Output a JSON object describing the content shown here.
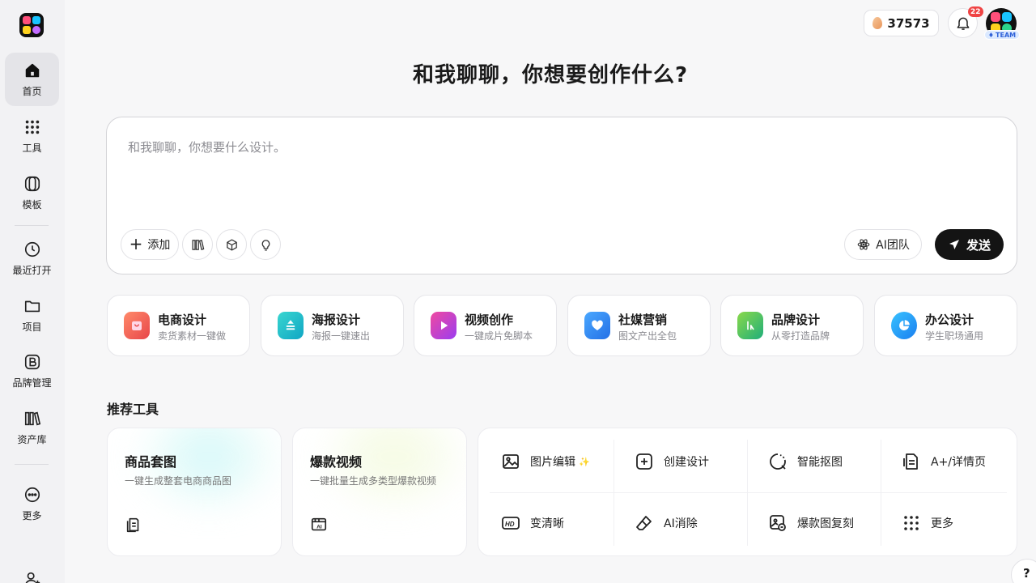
{
  "sidebar": {
    "items": [
      {
        "label": "首页",
        "icon": "home-icon"
      },
      {
        "label": "工具",
        "icon": "grid-dots-icon"
      },
      {
        "label": "模板",
        "icon": "template-icon"
      },
      {
        "label": "最近打开",
        "icon": "clock-icon"
      },
      {
        "label": "项目",
        "icon": "folder-icon"
      },
      {
        "label": "品牌管理",
        "icon": "brand-icon"
      },
      {
        "label": "资产库",
        "icon": "library-icon"
      },
      {
        "label": "更多",
        "icon": "more-icon"
      }
    ],
    "active_index": 0
  },
  "header": {
    "credits": "37573",
    "notification_count": "22",
    "team_badge": "TEAM"
  },
  "main": {
    "title": "和我聊聊，你想要创作什么?",
    "prompt": {
      "placeholder": "和我聊聊，你想要什么设计。",
      "value": "",
      "add_label": "添加",
      "ai_team_label": "AI团队",
      "send_label": "发送"
    },
    "categories": [
      {
        "title": "电商设计",
        "subtitle": "卖货素材一键做",
        "color": "#f05a4e"
      },
      {
        "title": "海报设计",
        "subtitle": "海报一键速出",
        "color": "#1fb8c9"
      },
      {
        "title": "视频创作",
        "subtitle": "一键成片免脚本",
        "color": "#c23be0"
      },
      {
        "title": "社媒营销",
        "subtitle": "图文产出全包",
        "color": "#2f8cf2"
      },
      {
        "title": "品牌设计",
        "subtitle": "从零打造品牌",
        "color": "#2db86a"
      },
      {
        "title": "办公设计",
        "subtitle": "学生职场通用",
        "color": "#1aa0f0"
      }
    ],
    "recommended_title": "推荐工具",
    "featured_tools": [
      {
        "title": "商品套图",
        "subtitle": "一键生成整套电商商品图",
        "icon": "product-set-icon"
      },
      {
        "title": "爆款视频",
        "subtitle": "一键批量生成多类型爆款视频",
        "icon": "ai-video-icon"
      }
    ],
    "tools": [
      {
        "label": "图片编辑",
        "icon": "image-edit-icon",
        "sparkle": "✨"
      },
      {
        "label": "创建设计",
        "icon": "create-design-icon"
      },
      {
        "label": "智能抠图",
        "icon": "cutout-icon"
      },
      {
        "label": "A+/详情页",
        "icon": "detail-page-icon"
      },
      {
        "label": "变清晰",
        "icon": "hd-icon"
      },
      {
        "label": "AI消除",
        "icon": "eraser-icon"
      },
      {
        "label": "爆款图复刻",
        "icon": "replicate-icon"
      },
      {
        "label": "更多",
        "icon": "more-dots-icon"
      }
    ]
  },
  "help_label": "?"
}
